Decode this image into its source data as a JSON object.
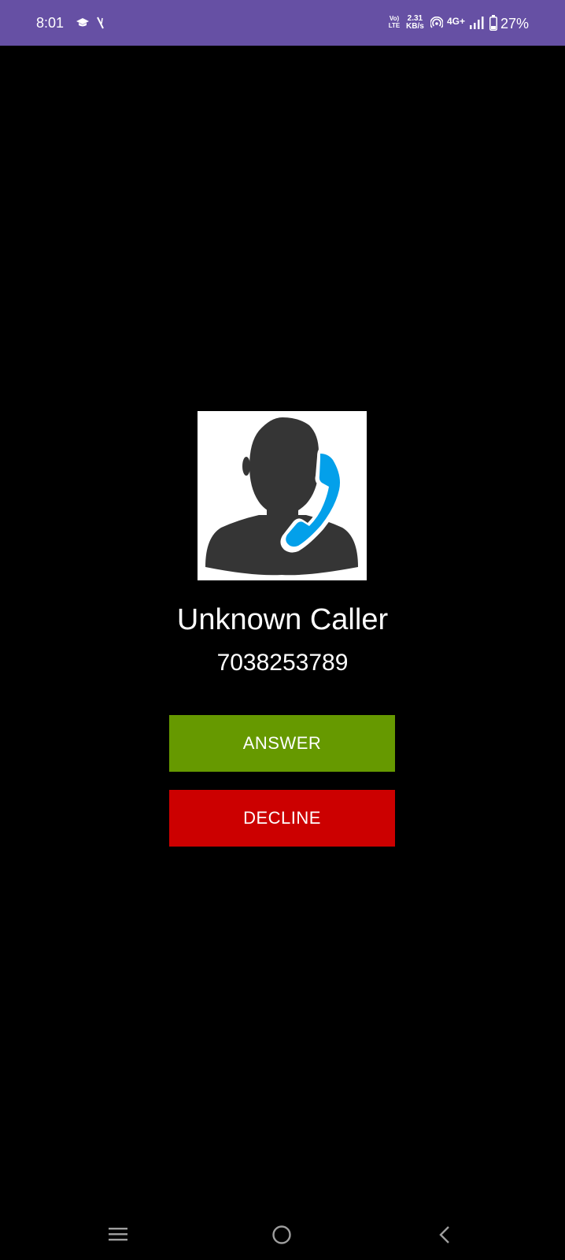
{
  "status_bar": {
    "time": "8:01",
    "volte_top": "Vo)",
    "volte_bottom": "LTE",
    "speed_value": "2.31",
    "speed_unit": "KB/s",
    "network_type": "4G+",
    "battery_percent": "27%",
    "icons": [
      "graduation-cap-icon",
      "feather-icon",
      "volte-icon",
      "hotspot-icon",
      "signal-icon",
      "battery-icon"
    ],
    "background_color": "#6650a4"
  },
  "call": {
    "caller_name": "Unknown Caller",
    "caller_number": "7038253789",
    "answer_label": "ANSWER",
    "decline_label": "DECLINE",
    "answer_color": "#669900",
    "decline_color": "#cc0000",
    "avatar_icon": "caller-avatar-icon"
  },
  "nav_bar": {
    "icons": [
      "recents-icon",
      "home-icon",
      "back-icon"
    ]
  }
}
